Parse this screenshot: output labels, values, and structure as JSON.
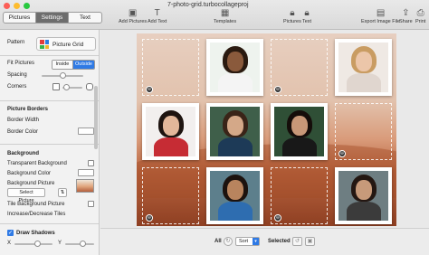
{
  "window": {
    "title": "7-photo-grid.turbocollageproj"
  },
  "tabs": [
    {
      "label": "Pictures"
    },
    {
      "label": "Settings"
    },
    {
      "label": "Text"
    }
  ],
  "toolbar": {
    "add_pictures": "Add Pictures",
    "add_text": "Add Text",
    "templates": "Templates",
    "pictures": "Pictures",
    "text": "Text",
    "export": "Export Image File",
    "share": "Share",
    "print": "Print"
  },
  "settings": {
    "pattern_label": "Pattern",
    "pattern_value": "Picture Grid",
    "fit_label": "Fit Pictures",
    "fit_options": [
      "Inside",
      "Outside"
    ],
    "fit_selected": "Outside",
    "spacing_label": "Spacing",
    "corners_label": "Corners",
    "borders_section": "Picture Borders",
    "border_width_label": "Border Width",
    "border_color_label": "Border Color",
    "background_section": "Background",
    "transparent_bg_label": "Transparent Background",
    "bg_color_label": "Background Color",
    "bg_picture_label": "Background Picture",
    "select_picture_button": "Select Picture",
    "tile_bg_label": "Tile Background Picture",
    "inc_dec_tiles_label": "Increase/Decrease Tiles",
    "draw_shadows_label": "Draw Shadows",
    "draw_shadows_checked": true,
    "x_label": "X",
    "y_label": "Y"
  },
  "bottom": {
    "all_label": "All",
    "sort_label": "Sort",
    "selected_label": "Selected"
  },
  "colors": {
    "accent": "#2f7ae5",
    "close": "#fc5f57",
    "minimize": "#fdbc2e",
    "zoom": "#28c840"
  }
}
